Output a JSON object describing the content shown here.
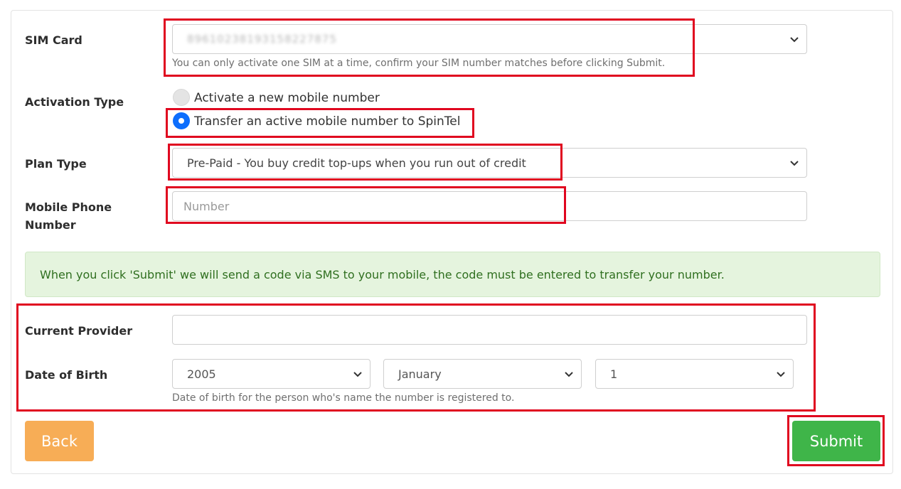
{
  "form": {
    "sim_card": {
      "label": "SIM Card",
      "value": "89610238193158227875",
      "help": "You can only activate one SIM at a time, confirm your SIM number matches before clicking Submit."
    },
    "activation_type": {
      "label": "Activation Type",
      "options": [
        {
          "label": "Activate a new mobile number",
          "selected": false
        },
        {
          "label": "Transfer an active mobile number to SpinTel",
          "selected": true
        }
      ]
    },
    "plan_type": {
      "label": "Plan Type",
      "value": "Pre-Paid - You buy credit top-ups when you run out of credit"
    },
    "mobile_number": {
      "label_line1": "Mobile Phone",
      "label_line2": "Number",
      "placeholder": "Number",
      "value": ""
    },
    "info_alert": "When you click 'Submit' we will send a code via SMS to your mobile, the code must be entered to transfer your number.",
    "current_provider": {
      "label": "Current Provider",
      "value": ""
    },
    "date_of_birth": {
      "label": "Date of Birth",
      "year": "2005",
      "month": "January",
      "day": "1",
      "help": "Date of birth for the person who's name the number is registered to."
    }
  },
  "buttons": {
    "back": "Back",
    "submit": "Submit"
  },
  "colors": {
    "back_button": "#f7ad56",
    "submit_button": "#3fb549",
    "radio_selected": "#0d6efd",
    "alert_background": "#e5f4de",
    "alert_text": "#2f6f1f",
    "highlight": "#e0061f"
  },
  "icons": {
    "select_chevron": "chevron-down-icon"
  }
}
